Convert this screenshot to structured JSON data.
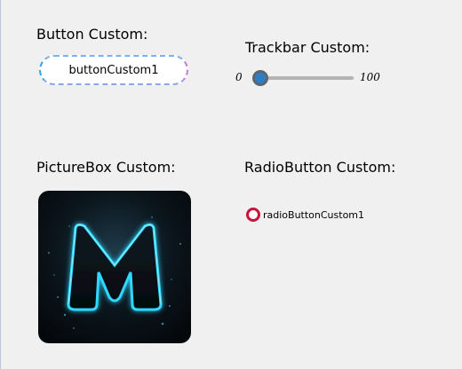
{
  "sections": {
    "button": {
      "title": "Button Custom:",
      "label": "buttonCustom1"
    },
    "trackbar": {
      "title": "Trackbar Custom:",
      "min_label": "0",
      "max_label": "100",
      "value": 0
    },
    "picturebox": {
      "title": "PictureBox Custom:",
      "image": "neon-m-logo"
    },
    "radio": {
      "title": "RadioButton Custom:",
      "label": "radioButtonCustom1",
      "checked": false
    }
  },
  "colors": {
    "form_background": "#f0f0f0",
    "button_border_primary": "#2ea6e8",
    "button_border_secondary": "#c978d8",
    "trackbar_thumb": "#2e7fc1",
    "trackbar_track": "#b3b3b3",
    "radio_ring": "#c8143c",
    "neon_glow": "#29d3ff"
  }
}
